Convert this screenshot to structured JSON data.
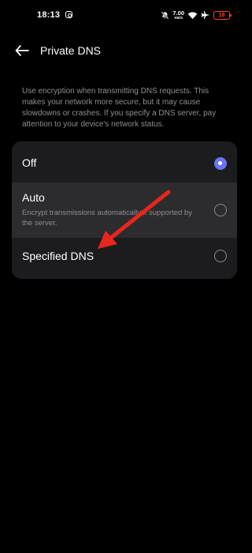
{
  "status_bar": {
    "time": "18:13",
    "net_speed_value": "7.00",
    "net_speed_unit": "KB/S",
    "battery_level": "18",
    "icons": [
      "instagram-icon",
      "mute-icon",
      "wifi-icon",
      "airplane-icon",
      "battery-icon"
    ]
  },
  "header": {
    "back_icon": "arrow-left-icon",
    "title": "Private DNS"
  },
  "description": "Use encryption when transmitting DNS requests. This makes your network more secure, but it may cause slowdowns or crashes. If you specify a DNS server, pay attention to your device's network status.",
  "options": [
    {
      "label": "Off",
      "sublabel": "",
      "selected": true
    },
    {
      "label": "Auto",
      "sublabel": "Encrypt transmissions automatically if supported by the server.",
      "selected": false
    },
    {
      "label": "Specified DNS",
      "sublabel": "",
      "selected": false
    }
  ],
  "colors": {
    "background": "#000000",
    "card": "#1c1c1e",
    "card_highlight": "#2c2c2e",
    "accent": "#6b75f2",
    "secondary_text": "#8e8e8e",
    "battery_low": "#ff3b30",
    "annotation_arrow": "#e8261c"
  },
  "annotation": {
    "type": "red-arrow",
    "points_to": "Specified DNS"
  }
}
